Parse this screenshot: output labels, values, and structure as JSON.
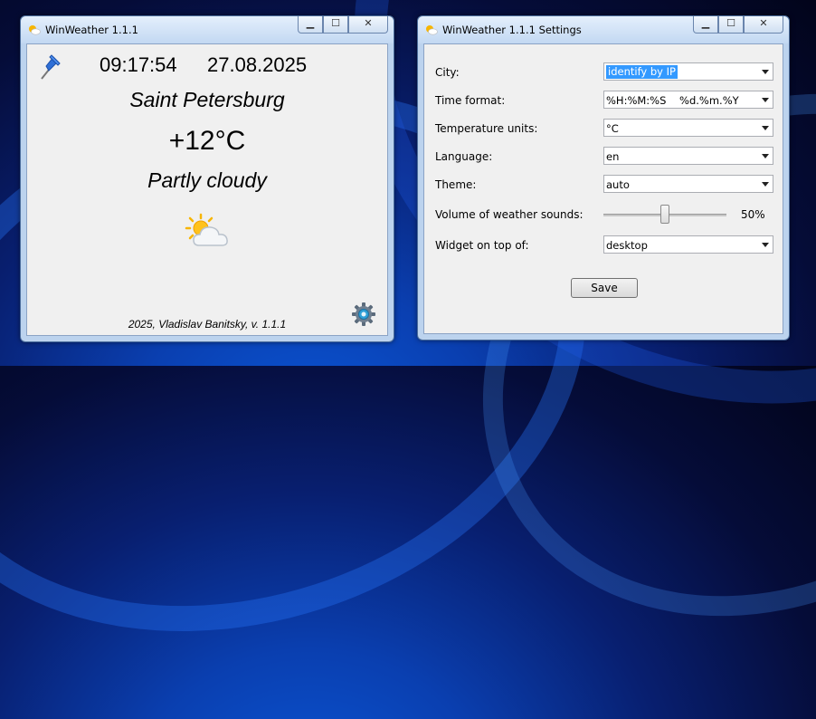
{
  "weather_window": {
    "title": "WinWeather 1.1.1",
    "time": "09:17:54",
    "date": "27.08.2025",
    "city": "Saint Petersburg",
    "temperature": "+12°C",
    "condition": "Partly cloudy",
    "condition_icon": "partly-cloudy-icon",
    "footer": "2025, Vladislav Banitsky, v. 1.1.1"
  },
  "settings_window": {
    "title": "WinWeather 1.1.1 Settings",
    "city_label": "City:",
    "city_value": "identify by IP",
    "time_format_label": "Time format:",
    "time_format_value": "%H:%M:%S    %d.%m.%Y",
    "temp_units_label": "Temperature units:",
    "temp_units_value": "°C",
    "language_label": "Language:",
    "language_value": "en",
    "theme_label": "Theme:",
    "theme_value": "auto",
    "volume_label": "Volume of weather sounds:",
    "volume_value": "50%",
    "volume_fraction": 0.5,
    "on_top_label": "Widget on top of:",
    "on_top_value": "desktop",
    "save_label": "Save"
  },
  "colors": {
    "selection": "#3399ff",
    "sun": "#f7b500",
    "titlebar": "#c2d8f2"
  }
}
